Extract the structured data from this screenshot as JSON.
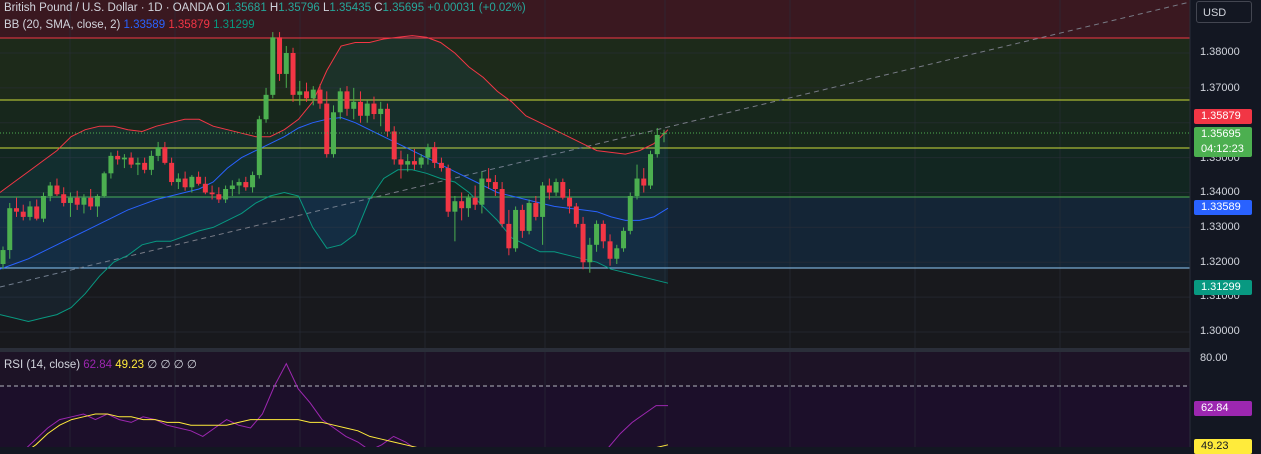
{
  "header": {
    "symbol": "British Pound / U.S. Dollar · 1D · OANDA",
    "open_label": "O",
    "open": "1.35681",
    "high_label": "H",
    "high": "1.35796",
    "low_label": "L",
    "low": "1.35435",
    "close_label": "C",
    "close": "1.35695",
    "change": "+0.00031 (+0.02%)"
  },
  "bb_legend": {
    "name": "BB (20, SMA, close, 2)",
    "basis": "1.33589",
    "upper": "1.35879",
    "lower": "1.31299"
  },
  "rsi_legend": {
    "name": "RSI (14, close)",
    "rsi": "62.84",
    "ma": "49.23",
    "extras": "∅ ∅ ∅ ∅"
  },
  "currency_button": "USD",
  "price_axis": {
    "ticks": [
      "1.38000",
      "1.37000",
      "1.35000",
      "1.34000",
      "1.33000",
      "1.32000",
      "1.31000",
      "1.30000"
    ],
    "tags": {
      "upper": "1.35879",
      "last_price": "1.35695",
      "countdown": "04:12:23",
      "basis": "1.33589",
      "lower": "1.31299"
    }
  },
  "rsi_axis": {
    "ticks": [
      "80.00"
    ],
    "rsi_tag": "62.84",
    "ma_tag": "49.23"
  },
  "colors": {
    "background": "#131722",
    "up": "#4caf50",
    "down": "#f23645",
    "bb_basis": "#2962ff",
    "bb_upper": "#f23645",
    "bb_lower": "#089981",
    "rsi": "#9c27b0",
    "rsi_ma": "#ffeb3b"
  },
  "chart_data": {
    "type": "candlestick",
    "price_range": [
      1.296,
      1.3875
    ],
    "rsi_range": [
      38,
      82
    ],
    "rsi_bands": [
      30,
      70
    ],
    "candles": [
      {
        "o": 1.3195,
        "h": 1.3245,
        "l": 1.318,
        "c": 1.3235
      },
      {
        "o": 1.3235,
        "h": 1.337,
        "l": 1.321,
        "c": 1.3355
      },
      {
        "o": 1.3355,
        "h": 1.3385,
        "l": 1.333,
        "c": 1.3345
      },
      {
        "o": 1.3345,
        "h": 1.3365,
        "l": 1.332,
        "c": 1.333
      },
      {
        "o": 1.333,
        "h": 1.3375,
        "l": 1.332,
        "c": 1.336
      },
      {
        "o": 1.336,
        "h": 1.338,
        "l": 1.332,
        "c": 1.3325
      },
      {
        "o": 1.3325,
        "h": 1.34,
        "l": 1.3315,
        "c": 1.339
      },
      {
        "o": 1.339,
        "h": 1.343,
        "l": 1.3375,
        "c": 1.342
      },
      {
        "o": 1.342,
        "h": 1.344,
        "l": 1.339,
        "c": 1.3395
      },
      {
        "o": 1.3395,
        "h": 1.3415,
        "l": 1.336,
        "c": 1.337
      },
      {
        "o": 1.337,
        "h": 1.34,
        "l": 1.333,
        "c": 1.3385
      },
      {
        "o": 1.3385,
        "h": 1.3405,
        "l": 1.335,
        "c": 1.3365
      },
      {
        "o": 1.3365,
        "h": 1.3395,
        "l": 1.334,
        "c": 1.3385
      },
      {
        "o": 1.3385,
        "h": 1.341,
        "l": 1.335,
        "c": 1.336
      },
      {
        "o": 1.336,
        "h": 1.3395,
        "l": 1.333,
        "c": 1.339
      },
      {
        "o": 1.339,
        "h": 1.346,
        "l": 1.3385,
        "c": 1.3455
      },
      {
        "o": 1.3455,
        "h": 1.3515,
        "l": 1.344,
        "c": 1.3505
      },
      {
        "o": 1.3505,
        "h": 1.352,
        "l": 1.348,
        "c": 1.3495
      },
      {
        "o": 1.3495,
        "h": 1.351,
        "l": 1.347,
        "c": 1.35
      },
      {
        "o": 1.35,
        "h": 1.3515,
        "l": 1.347,
        "c": 1.348
      },
      {
        "o": 1.348,
        "h": 1.35,
        "l": 1.345,
        "c": 1.3485
      },
      {
        "o": 1.3485,
        "h": 1.35,
        "l": 1.3455,
        "c": 1.3465
      },
      {
        "o": 1.3465,
        "h": 1.352,
        "l": 1.345,
        "c": 1.3505
      },
      {
        "o": 1.3505,
        "h": 1.3545,
        "l": 1.349,
        "c": 1.353
      },
      {
        "o": 1.353,
        "h": 1.3545,
        "l": 1.348,
        "c": 1.3485
      },
      {
        "o": 1.3485,
        "h": 1.35,
        "l": 1.342,
        "c": 1.343
      },
      {
        "o": 1.343,
        "h": 1.3455,
        "l": 1.341,
        "c": 1.344
      },
      {
        "o": 1.344,
        "h": 1.346,
        "l": 1.3405,
        "c": 1.3415
      },
      {
        "o": 1.3415,
        "h": 1.345,
        "l": 1.34,
        "c": 1.3445
      },
      {
        "o": 1.3445,
        "h": 1.346,
        "l": 1.342,
        "c": 1.3425
      },
      {
        "o": 1.3425,
        "h": 1.3445,
        "l": 1.3395,
        "c": 1.34
      },
      {
        "o": 1.34,
        "h": 1.342,
        "l": 1.338,
        "c": 1.3395
      },
      {
        "o": 1.3395,
        "h": 1.3415,
        "l": 1.337,
        "c": 1.338
      },
      {
        "o": 1.338,
        "h": 1.342,
        "l": 1.337,
        "c": 1.341
      },
      {
        "o": 1.341,
        "h": 1.3435,
        "l": 1.339,
        "c": 1.342
      },
      {
        "o": 1.342,
        "h": 1.344,
        "l": 1.3395,
        "c": 1.343
      },
      {
        "o": 1.343,
        "h": 1.3445,
        "l": 1.3405,
        "c": 1.3415
      },
      {
        "o": 1.3415,
        "h": 1.346,
        "l": 1.34,
        "c": 1.345
      },
      {
        "o": 1.345,
        "h": 1.362,
        "l": 1.344,
        "c": 1.361
      },
      {
        "o": 1.361,
        "h": 1.37,
        "l": 1.36,
        "c": 1.368
      },
      {
        "o": 1.368,
        "h": 1.386,
        "l": 1.367,
        "c": 1.3845
      },
      {
        "o": 1.3845,
        "h": 1.386,
        "l": 1.372,
        "c": 1.374
      },
      {
        "o": 1.374,
        "h": 1.382,
        "l": 1.37,
        "c": 1.38
      },
      {
        "o": 1.38,
        "h": 1.3815,
        "l": 1.366,
        "c": 1.368
      },
      {
        "o": 1.368,
        "h": 1.372,
        "l": 1.365,
        "c": 1.369
      },
      {
        "o": 1.369,
        "h": 1.3715,
        "l": 1.366,
        "c": 1.367
      },
      {
        "o": 1.367,
        "h": 1.3705,
        "l": 1.365,
        "c": 1.3695
      },
      {
        "o": 1.3695,
        "h": 1.371,
        "l": 1.364,
        "c": 1.3655
      },
      {
        "o": 1.3655,
        "h": 1.369,
        "l": 1.35,
        "c": 1.351
      },
      {
        "o": 1.351,
        "h": 1.365,
        "l": 1.35,
        "c": 1.363
      },
      {
        "o": 1.363,
        "h": 1.37,
        "l": 1.361,
        "c": 1.369
      },
      {
        "o": 1.369,
        "h": 1.3705,
        "l": 1.362,
        "c": 1.364
      },
      {
        "o": 1.364,
        "h": 1.37,
        "l": 1.361,
        "c": 1.366
      },
      {
        "o": 1.366,
        "h": 1.369,
        "l": 1.36,
        "c": 1.362
      },
      {
        "o": 1.362,
        "h": 1.3665,
        "l": 1.36,
        "c": 1.3655
      },
      {
        "o": 1.3655,
        "h": 1.3675,
        "l": 1.361,
        "c": 1.3625
      },
      {
        "o": 1.3625,
        "h": 1.366,
        "l": 1.359,
        "c": 1.364
      },
      {
        "o": 1.364,
        "h": 1.3655,
        "l": 1.356,
        "c": 1.3575
      },
      {
        "o": 1.3575,
        "h": 1.359,
        "l": 1.348,
        "c": 1.3495
      },
      {
        "o": 1.3495,
        "h": 1.352,
        "l": 1.344,
        "c": 1.348
      },
      {
        "o": 1.348,
        "h": 1.351,
        "l": 1.346,
        "c": 1.349
      },
      {
        "o": 1.349,
        "h": 1.3525,
        "l": 1.3465,
        "c": 1.348
      },
      {
        "o": 1.348,
        "h": 1.351,
        "l": 1.347,
        "c": 1.35
      },
      {
        "o": 1.35,
        "h": 1.354,
        "l": 1.348,
        "c": 1.353
      },
      {
        "o": 1.353,
        "h": 1.3545,
        "l": 1.347,
        "c": 1.3485
      },
      {
        "o": 1.3485,
        "h": 1.35,
        "l": 1.346,
        "c": 1.347
      },
      {
        "o": 1.347,
        "h": 1.348,
        "l": 1.333,
        "c": 1.3345
      },
      {
        "o": 1.3345,
        "h": 1.339,
        "l": 1.326,
        "c": 1.3375
      },
      {
        "o": 1.3375,
        "h": 1.34,
        "l": 1.332,
        "c": 1.3355
      },
      {
        "o": 1.3355,
        "h": 1.3395,
        "l": 1.333,
        "c": 1.3385
      },
      {
        "o": 1.3385,
        "h": 1.342,
        "l": 1.335,
        "c": 1.3365
      },
      {
        "o": 1.3365,
        "h": 1.346,
        "l": 1.334,
        "c": 1.344
      },
      {
        "o": 1.344,
        "h": 1.347,
        "l": 1.341,
        "c": 1.343
      },
      {
        "o": 1.343,
        "h": 1.345,
        "l": 1.339,
        "c": 1.341
      },
      {
        "o": 1.341,
        "h": 1.343,
        "l": 1.33,
        "c": 1.331
      },
      {
        "o": 1.331,
        "h": 1.335,
        "l": 1.322,
        "c": 1.324
      },
      {
        "o": 1.324,
        "h": 1.336,
        "l": 1.323,
        "c": 1.335
      },
      {
        "o": 1.335,
        "h": 1.3365,
        "l": 1.327,
        "c": 1.329
      },
      {
        "o": 1.329,
        "h": 1.338,
        "l": 1.328,
        "c": 1.337
      },
      {
        "o": 1.337,
        "h": 1.339,
        "l": 1.332,
        "c": 1.333
      },
      {
        "o": 1.333,
        "h": 1.343,
        "l": 1.325,
        "c": 1.342
      },
      {
        "o": 1.342,
        "h": 1.344,
        "l": 1.338,
        "c": 1.34
      },
      {
        "o": 1.34,
        "h": 1.344,
        "l": 1.339,
        "c": 1.343
      },
      {
        "o": 1.343,
        "h": 1.344,
        "l": 1.338,
        "c": 1.3385
      },
      {
        "o": 1.3385,
        "h": 1.341,
        "l": 1.334,
        "c": 1.336
      },
      {
        "o": 1.336,
        "h": 1.337,
        "l": 1.33,
        "c": 1.331
      },
      {
        "o": 1.331,
        "h": 1.333,
        "l": 1.318,
        "c": 1.32
      },
      {
        "o": 1.32,
        "h": 1.327,
        "l": 1.317,
        "c": 1.325
      },
      {
        "o": 1.325,
        "h": 1.332,
        "l": 1.323,
        "c": 1.331
      },
      {
        "o": 1.331,
        "h": 1.332,
        "l": 1.324,
        "c": 1.326
      },
      {
        "o": 1.326,
        "h": 1.328,
        "l": 1.319,
        "c": 1.321
      },
      {
        "o": 1.321,
        "h": 1.325,
        "l": 1.3195,
        "c": 1.324
      },
      {
        "o": 1.324,
        "h": 1.33,
        "l": 1.323,
        "c": 1.329
      },
      {
        "o": 1.329,
        "h": 1.34,
        "l": 1.328,
        "c": 1.339
      },
      {
        "o": 1.339,
        "h": 1.348,
        "l": 1.338,
        "c": 1.344
      },
      {
        "o": 1.344,
        "h": 1.347,
        "l": 1.34,
        "c": 1.342
      },
      {
        "o": 1.342,
        "h": 1.352,
        "l": 1.341,
        "c": 1.351
      },
      {
        "o": 1.351,
        "h": 1.3585,
        "l": 1.35,
        "c": 1.3565
      },
      {
        "o": 1.3568,
        "h": 1.358,
        "l": 1.3544,
        "c": 1.357
      }
    ],
    "bb_upper": [
      1.34,
      1.343,
      1.346,
      1.349,
      1.352,
      1.356,
      1.358,
      1.359,
      1.359,
      1.358,
      1.3575,
      1.359,
      1.36,
      1.361,
      1.361,
      1.359,
      1.358,
      1.357,
      1.356,
      1.356,
      1.358,
      1.361,
      1.366,
      1.375,
      1.382,
      1.383,
      1.383,
      1.384,
      1.3845,
      1.385,
      1.3845,
      1.383,
      1.38,
      1.376,
      1.373,
      1.369,
      1.366,
      1.362,
      1.36,
      1.358,
      1.356,
      1.354,
      1.352,
      1.3515,
      1.351,
      1.352,
      1.354,
      1.358
    ],
    "bb_basis": [
      1.318,
      1.3195,
      1.321,
      1.323,
      1.325,
      1.327,
      1.329,
      1.331,
      1.333,
      1.335,
      1.3365,
      1.338,
      1.339,
      1.34,
      1.341,
      1.343,
      1.347,
      1.35,
      1.352,
      1.354,
      1.356,
      1.3585,
      1.36,
      1.361,
      1.3615,
      1.36,
      1.358,
      1.356,
      1.354,
      1.352,
      1.35,
      1.348,
      1.346,
      1.344,
      1.342,
      1.34,
      1.339,
      1.338,
      1.337,
      1.336,
      1.3355,
      1.335,
      1.3345,
      1.333,
      1.332,
      1.332,
      1.333,
      1.3355
    ],
    "bb_lower": [
      1.305,
      1.304,
      1.303,
      1.304,
      1.305,
      1.307,
      1.311,
      1.316,
      1.32,
      1.322,
      1.325,
      1.326,
      1.326,
      1.3275,
      1.329,
      1.33,
      1.332,
      1.334,
      1.337,
      1.339,
      1.34,
      1.339,
      1.33,
      1.324,
      1.325,
      1.328,
      1.338,
      1.344,
      1.3465,
      1.3465,
      1.3455,
      1.344,
      1.343,
      1.34,
      1.336,
      1.332,
      1.327,
      1.325,
      1.323,
      1.323,
      1.322,
      1.321,
      1.32,
      1.318,
      1.317,
      1.316,
      1.315,
      1.314
    ],
    "rsi": [
      43,
      44,
      47,
      51,
      55,
      58,
      59,
      60,
      58,
      60,
      58,
      57,
      59,
      58,
      56,
      55,
      54,
      52,
      55,
      58,
      56,
      55,
      60,
      70,
      78,
      69,
      64,
      58,
      55,
      52,
      50,
      47,
      49,
      52,
      50,
      47,
      44,
      43,
      42,
      41,
      42,
      43,
      45,
      47,
      45,
      42,
      43,
      45,
      47,
      45,
      42,
      48,
      53,
      57,
      60,
      63,
      63
    ],
    "rsi_ma": [
      40,
      43,
      46,
      49,
      53,
      56,
      58,
      59,
      60,
      60,
      59,
      59,
      58,
      58,
      57,
      57,
      56,
      56,
      56,
      56,
      57,
      58,
      58,
      58,
      58,
      58,
      57,
      57,
      56,
      55,
      54,
      52,
      51,
      50,
      49,
      48,
      47,
      46,
      45,
      44,
      43,
      42,
      41,
      41,
      41,
      40,
      40,
      39,
      39,
      39,
      40,
      41,
      43,
      45,
      47,
      48,
      49
    ]
  }
}
